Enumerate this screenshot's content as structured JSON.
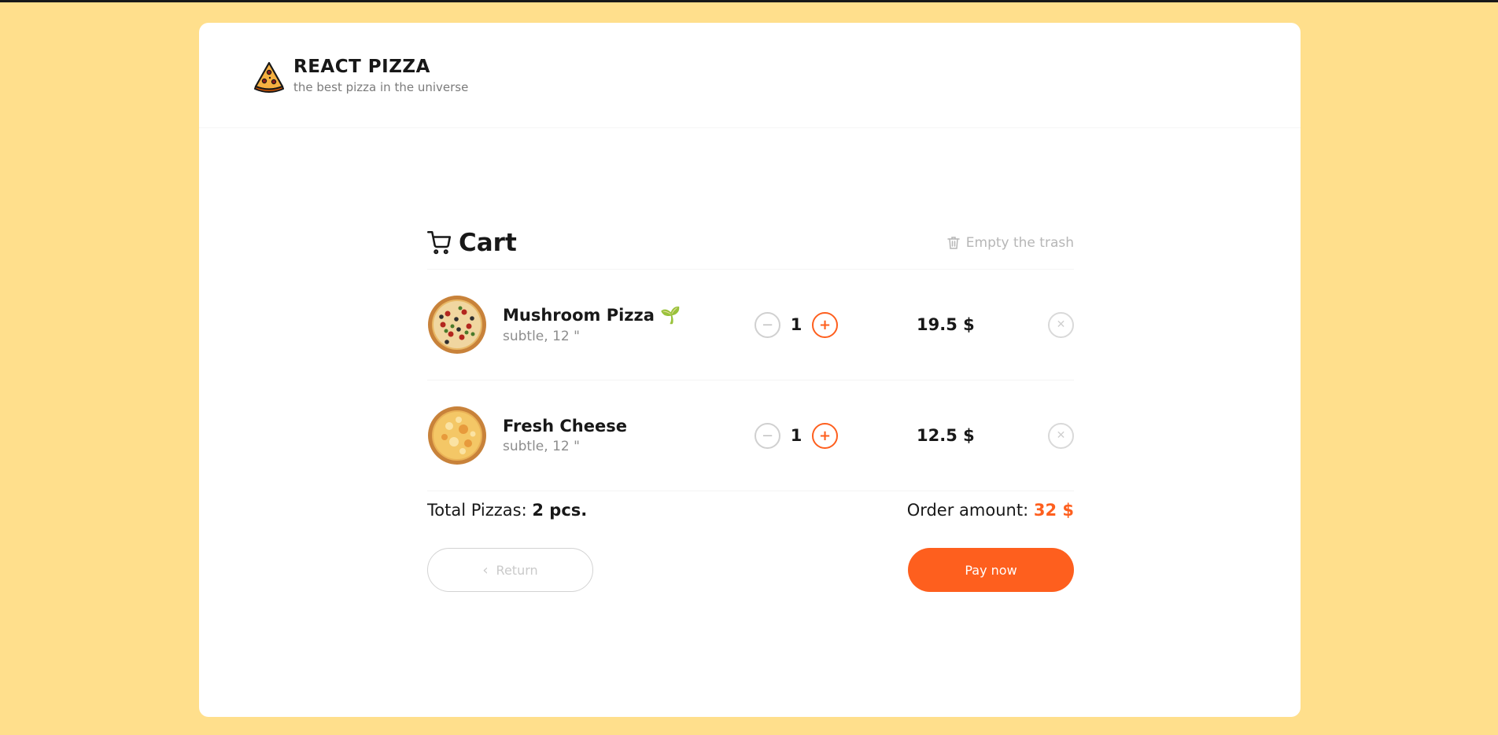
{
  "brand": {
    "title": "REACT PIZZA",
    "subtitle": "the best pizza in the universe",
    "logo_icon": "pizza-slice-icon"
  },
  "cart": {
    "title": "Cart",
    "clear_label": "Empty the trash",
    "items": [
      {
        "name": "Mushroom Pizza 🌱",
        "meta": "subtle, 12 \"",
        "count": "1",
        "price": "19.5 $",
        "image": "mushroom-pizza"
      },
      {
        "name": "Fresh Cheese",
        "meta": "subtle, 12 \"",
        "count": "1",
        "price": "12.5 $",
        "image": "cheese-pizza"
      }
    ],
    "total_label": "Total Pizzas:",
    "total_value": "2 pcs.",
    "amount_label": "Order amount:",
    "amount_value": "32 $",
    "return_label": "Return",
    "pay_label": "Pay now"
  },
  "colors": {
    "accent": "#fe5f1e",
    "background": "#ffdf8c"
  }
}
